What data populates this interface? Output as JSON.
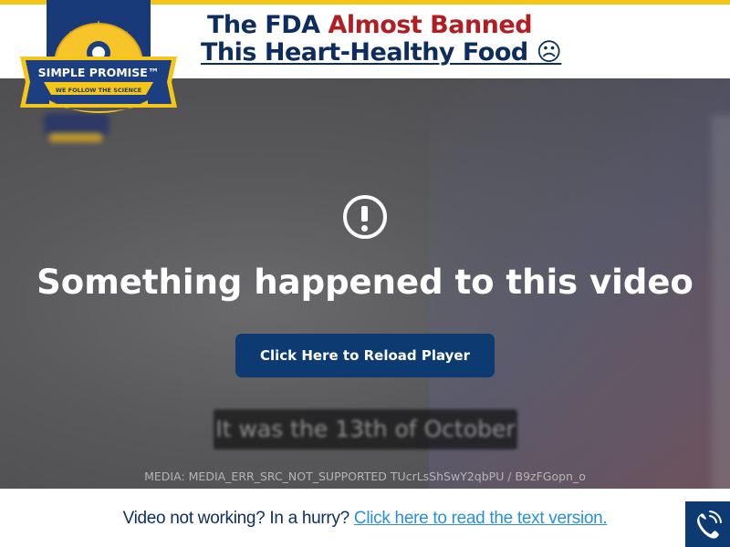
{
  "header": {
    "headline_part1": "The FDA ",
    "headline_highlight": "Almost Banned",
    "headline_line2": "This Heart-Healthy Food",
    "headline_emoji": "☹",
    "colors": {
      "navy": "#0d2d5e",
      "red": "#b01e23",
      "yellow": "#f5c518"
    }
  },
  "logo": {
    "brand": "SIMPLE PROMISE™",
    "tagline": "WE FOLLOW THE SCIENCE"
  },
  "video": {
    "error_icon": "exclamation-circle-icon",
    "error_title": "Something happened to this video",
    "reload_label": "Click Here to Reload Player",
    "caption": "It was the 13th of October",
    "media_error": "MEDIA: MEDIA_ERR_SRC_NOT_SUPPORTED TUcrLsShSwY2qbPU / B9zFGopn_o"
  },
  "bottom_bar": {
    "prompt": "Video not working? In a hurry? ",
    "link": "Click here to read the text version.",
    "phone_icon": "phone-icon"
  }
}
